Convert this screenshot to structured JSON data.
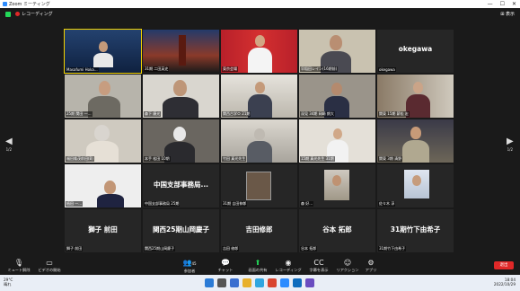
{
  "window": {
    "title": "Zoom ミーティング",
    "min": "—",
    "max": "☐",
    "close": "✕"
  },
  "topbar": {
    "recording": "レコーディング",
    "view": "⊞ 表示"
  },
  "nav": {
    "prev": "◀",
    "next": "▶",
    "page_left": "1/2",
    "page_right": "1/2"
  },
  "tiles": [
    {
      "name": "Masafumi Hoka...",
      "big": ""
    },
    {
      "name": "31期 二田英史",
      "big": ""
    },
    {
      "name": "東京会場",
      "big": ""
    },
    {
      "name": "早稲田レイン(16期前)",
      "big": ""
    },
    {
      "name": "okegawa",
      "big": "okegawa"
    },
    {
      "name": "25期 関田 一…",
      "big": ""
    },
    {
      "name": "森下 康光",
      "big": ""
    },
    {
      "name": "関西古学Ｏ 21期",
      "big": ""
    },
    {
      "name": "深見 34期 岡崎 朗大",
      "big": ""
    },
    {
      "name": "関東 15期 薪松 宏",
      "big": ""
    },
    {
      "name": "福田隆茂前田(B)",
      "big": ""
    },
    {
      "name": "本手 松田 10期",
      "big": ""
    },
    {
      "name": "竹田 真光先生",
      "big": ""
    },
    {
      "name": "15期 真光先生 31期",
      "big": ""
    },
    {
      "name": "関東 3期 清野",
      "big": ""
    },
    {
      "name": "植田 一…",
      "big": ""
    },
    {
      "name": "中国支部事務局 25期",
      "big": "中国支部事務局..."
    },
    {
      "name": "31期 吉田伸郎",
      "big": ""
    },
    {
      "name": "森 好…",
      "big": ""
    },
    {
      "name": "佐々木 淳",
      "big": ""
    },
    {
      "name": "獅子 前田",
      "big": "獅子 前田"
    },
    {
      "name": "関西25期山岡慶子",
      "big": "関西25期山岡慶子"
    },
    {
      "name": "吉田 修郎",
      "big": "吉田修郎"
    },
    {
      "name": "谷本 拓郎",
      "big": "谷本 拓郎"
    },
    {
      "name": "31期竹下由希子",
      "big": "31期竹下由希子"
    }
  ],
  "toolbar": {
    "mute": "ミュート解除",
    "video": "ビデオの開始",
    "participants": "参加者",
    "participants_count": "45",
    "chat": "チャット",
    "share": "画面の共有",
    "record": "レコーディング",
    "captions": "字幕を表示",
    "reactions": "リアクション",
    "apps": "アプリ",
    "end": "退出"
  },
  "taskbar": {
    "temp": "29°C",
    "weather": "晴れ",
    "time": "18:04",
    "date": "2022/10/29"
  }
}
